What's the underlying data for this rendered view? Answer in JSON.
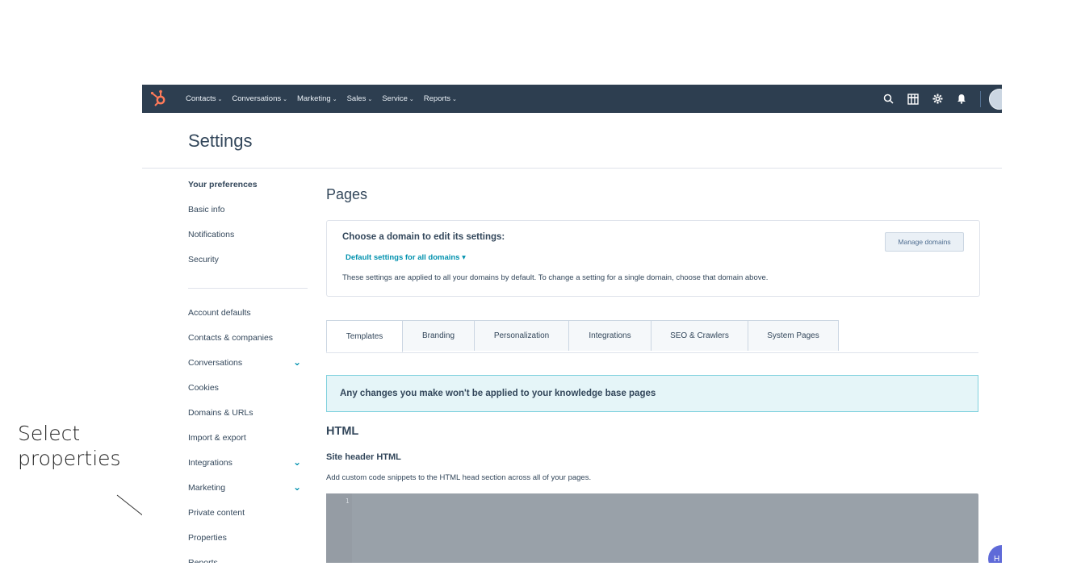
{
  "annotation": {
    "line1": "Select",
    "line2": "properties"
  },
  "topnav": {
    "items": [
      "Contacts",
      "Conversations",
      "Marketing",
      "Sales",
      "Service",
      "Reports"
    ],
    "caret": "⌄"
  },
  "header": {
    "title": "Settings"
  },
  "sidebar": {
    "heading": "Your preferences",
    "pref_items": [
      "Basic info",
      "Notifications",
      "Security"
    ],
    "account_items": [
      "Account defaults",
      "Contacts & companies",
      "Conversations",
      "Cookies",
      "Domains & URLs",
      "Import & export",
      "Integrations",
      "Marketing",
      "Private content",
      "Properties",
      "Reports"
    ],
    "chevron": "⌄"
  },
  "main": {
    "title": "Pages",
    "domain": {
      "label": "Choose a domain to edit its settings:",
      "selected": "Default settings for all domains ▾",
      "description": "These settings are applied to all your domains by default. To change a setting for a single domain, choose that domain above.",
      "manage_button": "Manage domains"
    },
    "tabs": [
      "Templates",
      "Branding",
      "Personalization",
      "Integrations",
      "SEO & Crawlers",
      "System Pages"
    ],
    "active_tab": "Templates",
    "banner": "Any changes you make won't be applied to your knowledge base pages",
    "html_heading": "HTML",
    "site_header": {
      "title": "Site header HTML",
      "description": "Add custom code snippets to the HTML head section across all of your pages.",
      "line_number": "1"
    }
  },
  "help": {
    "label": "H"
  },
  "colors": {
    "nav_bg": "#2d3e50",
    "accent": "#0091ae",
    "brand": "#ff7a59",
    "banner_bg": "#e5f5f8"
  }
}
